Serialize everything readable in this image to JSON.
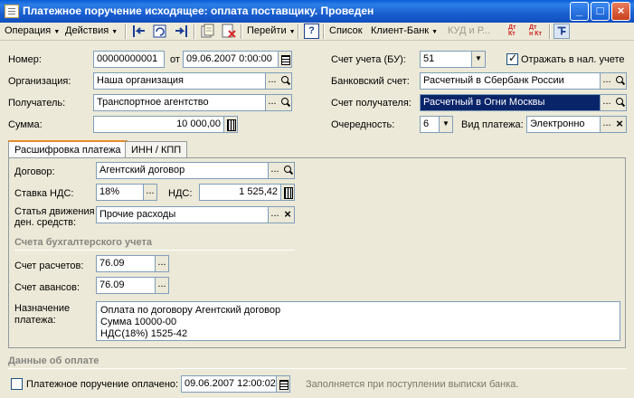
{
  "window": {
    "title": "Платежное поручение исходящее: оплата поставщику. Проведен",
    "minimize": "_",
    "maximize": "□",
    "close": "×"
  },
  "toolbar": {
    "operation": "Операция",
    "actions": "Действия",
    "goto": "Перейти",
    "help": "?",
    "list": "Список",
    "client_bank": "Клиент-Банк",
    "kud": "КУД и Р...",
    "dt_kt": "Дт Кт",
    "dt_kt2": "Дт н Кт"
  },
  "header": {
    "number_label": "Номер:",
    "number_value": "00000000001",
    "date_from_label": "от",
    "date_value": "09.06.2007  0:00:00",
    "org_label": "Организация:",
    "org_value": "Наша организация",
    "recipient_label": "Получатель:",
    "recipient_value": "Транспортное агентство",
    "sum_label": "Сумма:",
    "sum_value": "10 000,00",
    "account_label": "Счет учета (БУ):",
    "account_value": "51",
    "tax_checkbox_label": "Отражать в нал. учете",
    "tax_checked": true,
    "bank_account_label": "Банковский счет:",
    "bank_account_value": "Расчетный в Сбербанк России",
    "recipient_account_label": "Счет получателя:",
    "recipient_account_value": "Расчетный в Огни Москвы",
    "priority_label": "Очередность:",
    "priority_value": "6",
    "payment_type_label": "Вид платежа:",
    "payment_type_value": "Электронно"
  },
  "tabs": [
    {
      "label": "Расшифровка платежа",
      "active": true
    },
    {
      "label": "ИНН / КПП",
      "active": false
    }
  ],
  "payment_details": {
    "contract_label": "Договор:",
    "contract_value": "Агентский договор",
    "vat_rate_label": "Ставка НДС:",
    "vat_rate_value": "18%",
    "vat_label": "НДС:",
    "vat_value": "1 525,42",
    "cashflow_label_line1": "Статья движения",
    "cashflow_label_line2": "ден. средств:",
    "cashflow_value": "Прочие расходы",
    "accounting_group": "Счета бухгалтерского учета",
    "settlement_label": "Счет расчетов:",
    "settlement_value": "76.09",
    "advance_label": "Счет авансов:",
    "advance_value": "76.09",
    "purpose_label_line1": "Назначение",
    "purpose_label_line2": "платежа:",
    "purpose_lines": [
      "Оплата по договору Агентский договор",
      "Сумма 10000-00",
      "НДС(18%) 1525-42"
    ]
  },
  "payment_data": {
    "group": "Данные об оплате",
    "paid_label": "Платежное поручение оплачено:",
    "paid_checked": false,
    "paid_datetime": "09.06.2007 12:00:02",
    "hint": "Заполняется при поступлении выписки банка."
  }
}
